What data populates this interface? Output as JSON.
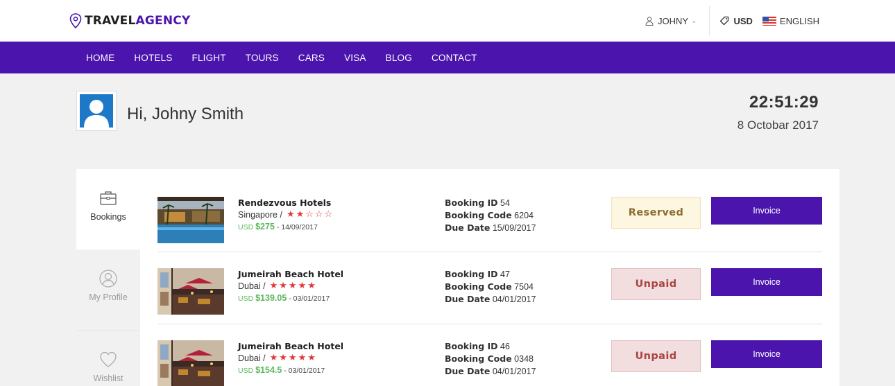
{
  "brand": {
    "part1": "TRAVEL",
    "part2": "AGENCY"
  },
  "header": {
    "user_name": "JOHNY",
    "currency": "USD",
    "language": "ENGLISH"
  },
  "nav": [
    "HOME",
    "HOTELS",
    "FLIGHT",
    "TOURS",
    "CARS",
    "VISA",
    "BLOG",
    "CONTACT"
  ],
  "greeting": "Hi, Johny Smith",
  "clock": {
    "time": "22:51:29",
    "date": "8 Octobar 2017"
  },
  "sidebar": {
    "tabs": [
      {
        "label": "Bookings",
        "icon": "briefcase-icon"
      },
      {
        "label": "My Profile",
        "icon": "user-circle-icon"
      },
      {
        "label": "Wishlist",
        "icon": "heart-icon"
      }
    ]
  },
  "bookings": [
    {
      "hotel": "Rendezvous Hotels",
      "location": "Singapore /",
      "stars_filled": 2,
      "stars_total": 5,
      "currency": "USD",
      "price": "$275",
      "date": "- 14/09/2017",
      "booking_id_label": "Booking ID",
      "booking_id": "54",
      "booking_code_label": "Booking Code",
      "booking_code": "6204",
      "due_date_label": "Due Date",
      "due_date": "15/09/2017",
      "status": "Reserved",
      "invoice_label": "Invoice"
    },
    {
      "hotel": "Jumeirah Beach Hotel",
      "location": "Dubai /",
      "stars_filled": 5,
      "stars_total": 5,
      "currency": "USD",
      "price": "$139.05",
      "date": "- 03/01/2017",
      "booking_id_label": "Booking ID",
      "booking_id": "47",
      "booking_code_label": "Booking Code",
      "booking_code": "7504",
      "due_date_label": "Due Date",
      "due_date": "04/01/2017",
      "status": "Unpaid",
      "invoice_label": "Invoice"
    },
    {
      "hotel": "Jumeirah Beach Hotel",
      "location": "Dubai /",
      "stars_filled": 5,
      "stars_total": 5,
      "currency": "USD",
      "price": "$154.5",
      "date": "- 03/01/2017",
      "booking_id_label": "Booking ID",
      "booking_id": "46",
      "booking_code_label": "Booking Code",
      "booking_code": "0348",
      "due_date_label": "Due Date",
      "due_date": "04/01/2017",
      "status": "Unpaid",
      "invoice_label": "Invoice"
    }
  ],
  "colors": {
    "brand": "#4b14ad",
    "price": "#5cb85c",
    "star": "#e0383c",
    "reserved_bg": "#fdf6e1",
    "unpaid_bg": "#f2dede"
  }
}
